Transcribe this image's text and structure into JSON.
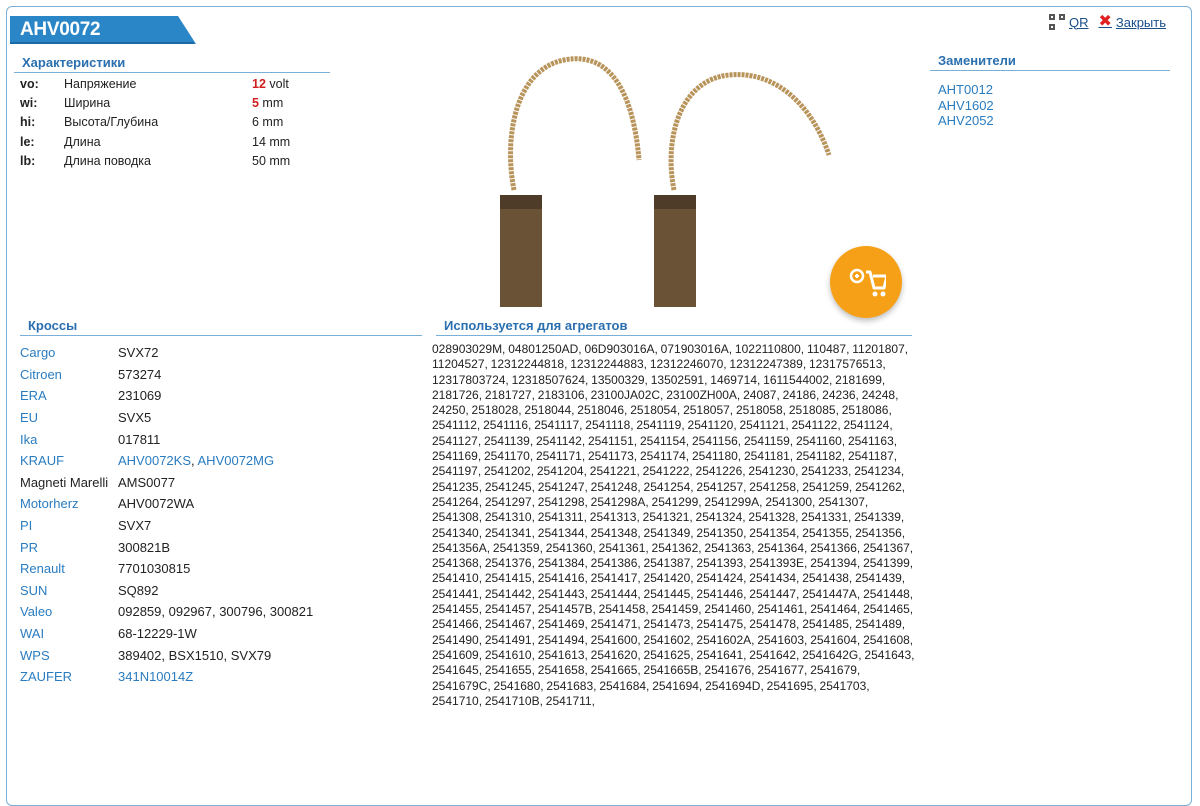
{
  "header": {
    "title": "AHV0072",
    "qr_label": "QR",
    "close_label": "Закрыть"
  },
  "specs": {
    "heading": "Характеристики",
    "rows": [
      {
        "code": "vo:",
        "label": "Напряжение",
        "value": "12",
        "unit": " volt",
        "highlight": true
      },
      {
        "code": "wi:",
        "label": "Ширина",
        "value": "5",
        "unit": " mm",
        "highlight": true
      },
      {
        "code": "hi:",
        "label": "Высота/Глубина",
        "value": "6 mm",
        "unit": "",
        "highlight": false
      },
      {
        "code": "le:",
        "label": "Длина",
        "value": "14 mm",
        "unit": "",
        "highlight": false
      },
      {
        "code": "lb:",
        "label": "Длина поводка",
        "value": "50 mm",
        "unit": "",
        "highlight": false
      }
    ]
  },
  "substitutes": {
    "heading": "Заменители",
    "items": [
      "AHT0012",
      "AHV1602",
      "AHV2052"
    ]
  },
  "crosses": {
    "heading": "Кроссы",
    "rows": [
      {
        "brand": "Cargo",
        "brand_link": true,
        "value": "SVX72",
        "value_link": false
      },
      {
        "brand": "Citroen",
        "brand_link": true,
        "value": "573274",
        "value_link": false
      },
      {
        "brand": "ERA",
        "brand_link": true,
        "value": "231069",
        "value_link": false
      },
      {
        "brand": "EU",
        "brand_link": true,
        "value": "SVX5",
        "value_link": false
      },
      {
        "brand": "Ika",
        "brand_link": true,
        "value": "017811",
        "value_link": false
      },
      {
        "brand": "KRAUF",
        "brand_link": true,
        "value": "AHV0072KS, AHV0072MG",
        "value_link": true
      },
      {
        "brand": "Magneti Marelli",
        "brand_link": false,
        "value": "AMS0077",
        "value_link": false
      },
      {
        "brand": "Motorherz",
        "brand_link": true,
        "value": "AHV0072WA",
        "value_link": false
      },
      {
        "brand": "PI",
        "brand_link": true,
        "value": "SVX7",
        "value_link": false
      },
      {
        "brand": "PR",
        "brand_link": true,
        "value": "300821B",
        "value_link": false
      },
      {
        "brand": "Renault",
        "brand_link": true,
        "value": "7701030815",
        "value_link": false
      },
      {
        "brand": "SUN",
        "brand_link": true,
        "value": "SQ892",
        "value_link": false
      },
      {
        "brand": "Valeo",
        "brand_link": true,
        "value": "092859, 092967, 300796, 300821",
        "value_link": false
      },
      {
        "brand": "WAI",
        "brand_link": true,
        "value": "68-12229-1W",
        "value_link": false
      },
      {
        "brand": "WPS",
        "brand_link": true,
        "value": "389402, BSX1510, SVX79",
        "value_link": false
      },
      {
        "brand": "ZAUFER",
        "brand_link": true,
        "value": "341N10014Z",
        "value_link": true
      }
    ]
  },
  "usage": {
    "heading": "Используется для агрегатов",
    "text": "028903029M, 04801250AD, 06D903016A, 071903016A, 1022110800, 110487, 11201807, 11204527, 12312244818, 12312244883, 12312246070, 12312247389, 12317576513, 12317803724, 12318507624, 13500329, 13502591, 1469714, 1611544002, 2181699, 2181726, 2181727, 2183106, 23100JA02C, 23100ZH00A, 24087, 24186, 24236, 24248, 24250, 2518028, 2518044, 2518046, 2518054, 2518057, 2518058, 2518085, 2518086, 2541112, 2541116, 2541117, 2541118, 2541119, 2541120, 2541121, 2541122, 2541124, 2541127, 2541139, 2541142, 2541151, 2541154, 2541156, 2541159, 2541160, 2541163, 2541169, 2541170, 2541171, 2541173, 2541174, 2541180, 2541181, 2541182, 2541187, 2541197, 2541202, 2541204, 2541221, 2541222, 2541226, 2541230, 2541233, 2541234, 2541235, 2541245, 2541247, 2541248, 2541254, 2541257, 2541258, 2541259, 2541262, 2541264, 2541297, 2541298, 2541298A, 2541299, 2541299A, 2541300, 2541307, 2541308, 2541310, 2541311, 2541313, 2541321, 2541324, 2541328, 2541331, 2541339, 2541340, 2541341, 2541344, 2541348, 2541349, 2541350, 2541354, 2541355, 2541356, 2541356A, 2541359, 2541360, 2541361, 2541362, 2541363, 2541364, 2541366, 2541367, 2541368, 2541376, 2541384, 2541386, 2541387, 2541393, 2541393E, 2541394, 2541399, 2541410, 2541415, 2541416, 2541417, 2541420, 2541424, 2541434, 2541438, 2541439, 2541441, 2541442, 2541443, 2541444, 2541445, 2541446, 2541447, 2541447A, 2541448, 2541455, 2541457, 2541457B, 2541458, 2541459, 2541460, 2541461, 2541464, 2541465, 2541466, 2541467, 2541469, 2541471, 2541473, 2541475, 2541478, 2541485, 2541489, 2541490, 2541491, 2541494, 2541600, 2541602, 2541602A, 2541603, 2541604, 2541608, 2541609, 2541610, 2541613, 2541620, 2541625, 2541641, 2541642, 2541642G, 2541643, 2541645, 2541655, 2541658, 2541665, 2541665B, 2541676, 2541677, 2541679, 2541679C, 2541680, 2541683, 2541684, 2541694, 2541694D, 2541695, 2541703, 2541710, 2541710B, 2541711,"
  },
  "colors": {
    "accent": "#2b86c8",
    "link": "#2a7cc0",
    "highlight": "#d02020",
    "cart": "#f5a016"
  }
}
